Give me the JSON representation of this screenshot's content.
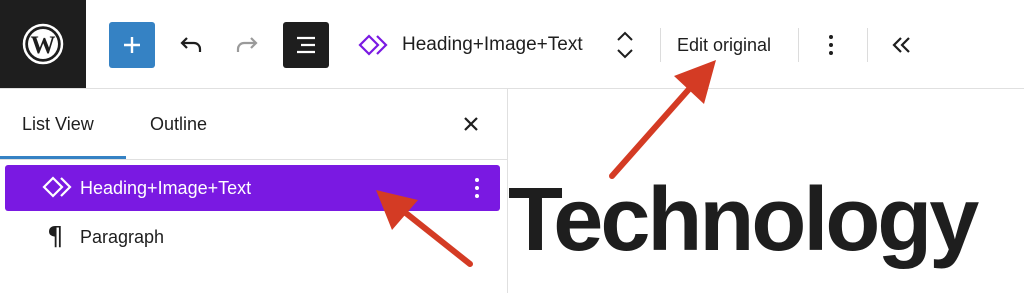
{
  "toolbar": {
    "block_title": "Heading+Image+Text",
    "edit_original": "Edit original"
  },
  "sidebar": {
    "tabs": [
      {
        "label": "List View"
      },
      {
        "label": "Outline"
      }
    ],
    "items": [
      {
        "label": "Heading+Image+Text",
        "icon": "synced-pattern-icon",
        "selected": true
      },
      {
        "label": "Paragraph",
        "icon": "paragraph-icon",
        "selected": false
      }
    ]
  },
  "canvas": {
    "heading": "Technology"
  },
  "colors": {
    "selection": "#7a19e2",
    "accent_blue": "#3582c4",
    "annotation_arrow": "#d43b24",
    "dark": "#1e1e1e"
  }
}
